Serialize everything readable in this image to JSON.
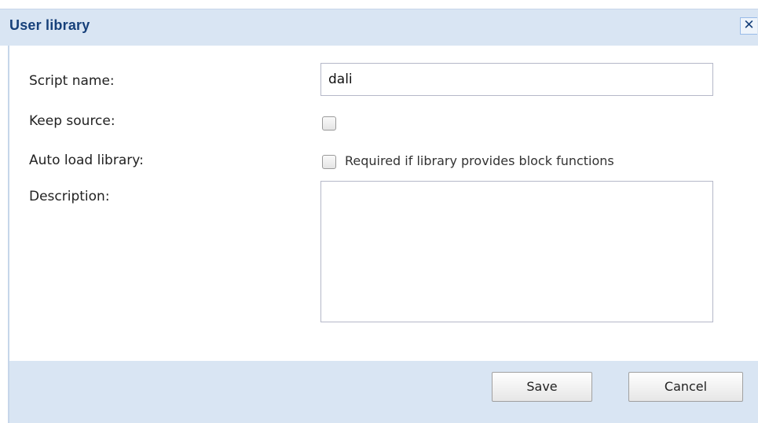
{
  "dialog": {
    "title": "User library",
    "close_glyph": "✕"
  },
  "form": {
    "script_name_label": "Script name:",
    "script_name_value": "dali",
    "keep_source_label": "Keep source:",
    "keep_source_checked": false,
    "auto_load_label": "Auto load library:",
    "auto_load_checked": false,
    "auto_load_note": "Required if library provides block functions",
    "description_label": "Description:",
    "description_value": ""
  },
  "footer": {
    "save_label": "Save",
    "cancel_label": "Cancel"
  },
  "colors": {
    "title_text": "#16407a",
    "header_bg": "#d9e5f3",
    "footer_bg": "#d9e5f3"
  },
  "icons": {
    "close": "close-icon"
  }
}
